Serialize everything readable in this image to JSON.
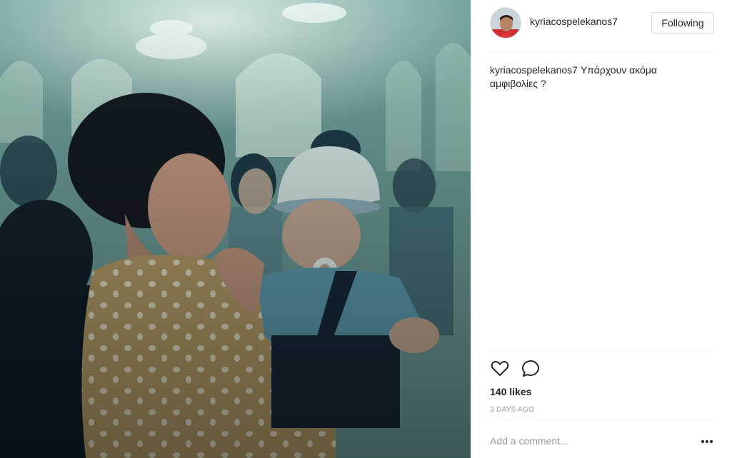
{
  "post": {
    "image_alt": "Vintage photo of a woman holding a baby with a pacifier in a church",
    "username": "kyriacospelekanos7",
    "follow_label": "Following",
    "caption": "Υπάρχουν ακόμα αμφιβολίες ?",
    "likes": "140 likes",
    "date": "3 DAYS AGO",
    "comment_placeholder": "Add a comment...",
    "icons": {
      "like": "heart-icon",
      "comment": "speech-bubble-icon",
      "more": "ellipsis-icon"
    }
  },
  "colors": {
    "text": "#262626",
    "muted": "#999999",
    "border": "#dbdbdb",
    "divider": "#efefef"
  }
}
